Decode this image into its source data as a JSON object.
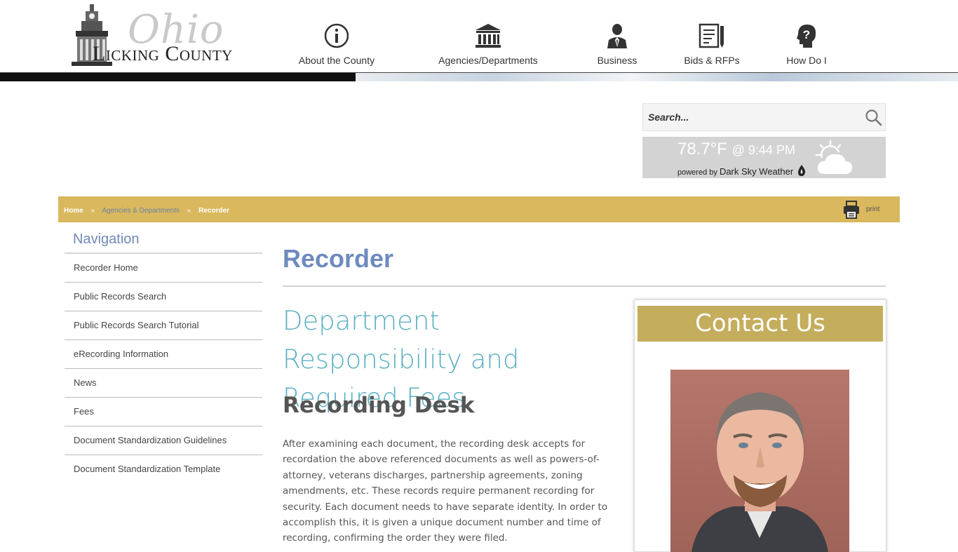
{
  "header": {
    "logo_word_ohio": "Ohio",
    "logo_word_county": "Licking County",
    "nav": [
      {
        "label": "About the County",
        "icon": "info-icon"
      },
      {
        "label": "Agencies/Departments",
        "icon": "building-icon"
      },
      {
        "label": "Business",
        "icon": "businessman-icon"
      },
      {
        "label": "Bids & RFPs",
        "icon": "document-pen-icon"
      },
      {
        "label": "How Do I",
        "icon": "question-head-icon"
      }
    ]
  },
  "search": {
    "placeholder": "Search...",
    "icon": "search-icon"
  },
  "weather": {
    "temperature": "78.7°F",
    "time": "@ 9:44 PM",
    "powered_by": "powered by",
    "provider": "Dark Sky Weather",
    "icon": "partly-cloudy-icon"
  },
  "breadcrumb": {
    "home": "Home",
    "separator": "»",
    "agencies": "Agencies & Departments",
    "current": "Recorder",
    "print_label": "print"
  },
  "sidenav": {
    "title": "Navigation",
    "items": [
      "Recorder Home",
      "Public Records Search",
      "Public Records Search Tutorial",
      "eRecording Information",
      "News",
      "Fees",
      "Document Standardization Guidelines",
      "Document Standardization Template"
    ]
  },
  "main": {
    "title": "Recorder",
    "heading": "Department Responsibility and Required Fees",
    "subheading": "Recording Desk",
    "paragraph": "After examining each document, the recording desk accepts for recordation the above referenced documents as well as powers-of-attorney, veterans discharges, partnership agreements, zoning amendments, etc. These records require permanent recording for security. Each document needs to have separate identity. In order to accomplish this, it is given a unique document number and time of recording, confirming the order they were filed."
  },
  "contact": {
    "title": "Contact Us"
  },
  "colors": {
    "gold_bar": "#d9b85e",
    "contact_gold": "#c4ad5c",
    "title_blue": "#6e8bbf",
    "heading_teal": "#5bb0c2"
  }
}
